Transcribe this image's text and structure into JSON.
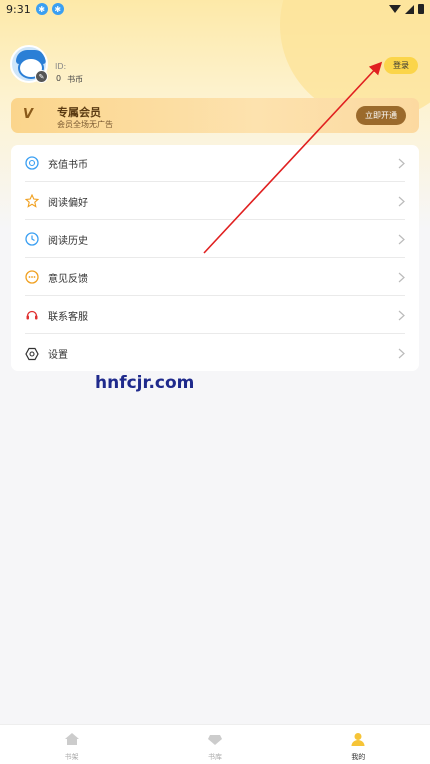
{
  "status_bar": {
    "time": "9:31"
  },
  "profile": {
    "id_label": "ID:",
    "coin_value": "0",
    "coin_label": "书币",
    "login_label": "登录"
  },
  "vip": {
    "title": "专属会员",
    "subtitle": "会员全场无广告",
    "button_label": "立即开通",
    "badge": "V"
  },
  "menu": {
    "items": [
      {
        "label": "充值书币",
        "icon": "coin-icon"
      },
      {
        "label": "阅读偏好",
        "icon": "star-icon"
      },
      {
        "label": "阅读历史",
        "icon": "clock-icon"
      },
      {
        "label": "意见反馈",
        "icon": "chat-icon"
      },
      {
        "label": "联系客服",
        "icon": "headset-icon"
      },
      {
        "label": "设置",
        "icon": "gear-icon"
      }
    ]
  },
  "watermark": "hnfcjr.com",
  "bottom_nav": {
    "items": [
      {
        "label": "书架",
        "icon": "home-icon",
        "active": false
      },
      {
        "label": "书库",
        "icon": "library-icon",
        "active": false
      },
      {
        "label": "我的",
        "icon": "profile-icon",
        "active": true
      }
    ]
  },
  "colors": {
    "accent": "#fbd54a",
    "vip_button": "#9b6a2c",
    "annotation_arrow": "#e02020",
    "watermark": "#1f2a8c"
  }
}
